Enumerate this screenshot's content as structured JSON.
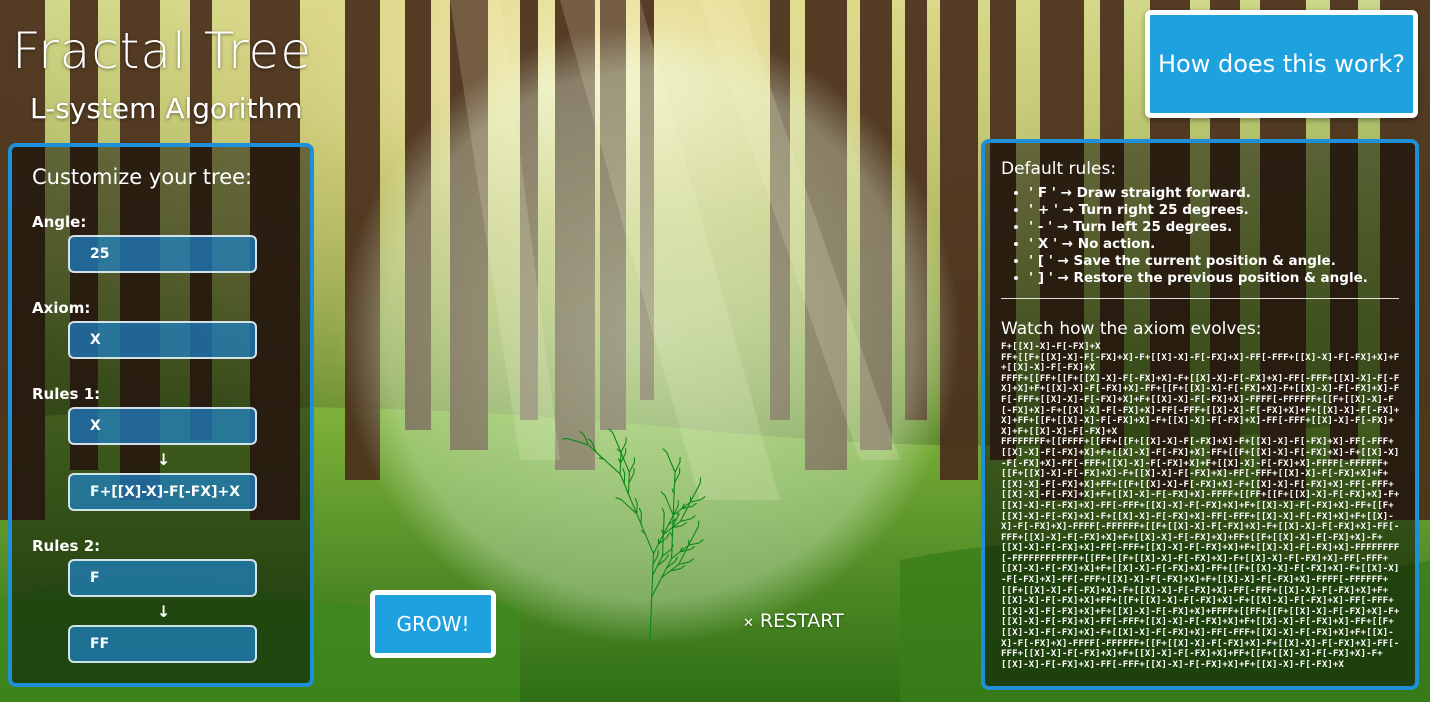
{
  "app": {
    "title": "Fractal Tree",
    "subtitle": "L-system Algorithm"
  },
  "buttons": {
    "how": "How does this work?",
    "grow": "GROW!",
    "restart": "RESTART"
  },
  "customize": {
    "heading": "Customize your tree:",
    "angle_label": "Angle:",
    "angle_value": "25",
    "axiom_label": "Axiom:",
    "axiom_value": "X",
    "rules1_label": "Rules 1:",
    "rules1_from": "X",
    "rules1_to": "F+[[X]-X]-F[-FX]+X",
    "rules2_label": "Rules 2:",
    "rules2_from": "F",
    "rules2_to": "FF",
    "arrow": "↓"
  },
  "rules_panel": {
    "heading": "Default rules:",
    "rules": [
      "' F ' → Draw straight forward.",
      "' + ' → Turn right 25 degrees.",
      "' - ' → Turn left 25 degrees.",
      "' X ' → No action.",
      "' [ ' → Save the current position & angle.",
      "' ] ' → Restore the previous position & angle."
    ],
    "evolve_heading": "Watch how the axiom evolves:",
    "evolution": [
      "F+[[X]-X]-F[-FX]+X",
      "FF+[[F+[[X]-X]-F[-FX]+X]-F+[[X]-X]-F[-FX]+X]-FF[-FFF+[[X]-X]-F[-FX]+X]+F+[[X]-X]-F[-FX]+X",
      "FFFF+[[FF+[[F+[[X]-X]-F[-FX]+X]-F+[[X]-X]-F[-FX]+X]-FF[-FFF+[[X]-X]-F[-FX]+X]+F+[[X]-X]-F[-FX]+X]-FF+[[F+[[X]-X]-F[-FX]+X]-F+[[X]-X]-F[-FX]+X]-FF[-FFF+[[X]-X]-F[-FX]+X]+F+[[X]-X]-F[-FX]+X]-FFFF[-FFFFFF+[[F+[[X]-X]-F[-FX]+X]-F+[[X]-X]-F[-FX]+X]-FF[-FFF+[[X]-X]-F[-FX]+X]+F+[[X]-X]-F[-FX]+X]+FF+[[F+[[X]-X]-F[-FX]+X]-F+[[X]-X]-F[-FX]+X]-FF[-FFF+[[X]-X]-F[-FX]+X]+F+[[X]-X]-F[-FX]+X",
      "FFFFFFFF+[[FFFF+[[FF+[[F+[[X]-X]-F[-FX]+X]-F+[[X]-X]-F[-FX]+X]-FF[-FFF+[[X]-X]-F[-FX]+X]+F+[[X]-X]-F[-FX]+X]-FF+[[F+[[X]-X]-F[-FX]+X]-F+[[X]-X]-F[-FX]+X]-FF[-FFF+[[X]-X]-F[-FX]+X]+F+[[X]-X]-F[-FX]+X]-FFFF[-FFFFFF+[[F+[[X]-X]-F[-FX]+X]-F+[[X]-X]-F[-FX]+X]-FF[-FFF+[[X]-X]-F[-FX]+X]+F+[[X]-X]-F[-FX]+X]+FF+[[F+[[X]-X]-F[-FX]+X]-F+[[X]-X]-F[-FX]+X]-FF[-FFF+[[X]-X]-F[-FX]+X]+F+[[X]-X]-F[-FX]+X]-FFFF+[[FF+[[F+[[X]-X]-F[-FX]+X]-F+[[X]-X]-F[-FX]+X]-FF[-FFF+[[X]-X]-F[-FX]+X]+F+[[X]-X]-F[-FX]+X]-FF+[[F+[[X]-X]-F[-FX]+X]-F+[[X]-X]-F[-FX]+X]-FF[-FFF+[[X]-X]-F[-FX]+X]+F+[[X]-X]-F[-FX]+X]-FFFF[-FFFFFF+[[F+[[X]-X]-F[-FX]+X]-F+[[X]-X]-F[-FX]+X]-FF[-FFF+[[X]-X]-F[-FX]+X]+F+[[X]-X]-F[-FX]+X]+FF+[[F+[[X]-X]-F[-FX]+X]-F+[[X]-X]-F[-FX]+X]-FF[-FFF+[[X]-X]-F[-FX]+X]+F+[[X]-X]-F[-FX]+X]-FFFFFFFF[-FFFFFFFFFFFF+[[FF+[[F+[[X]-X]-F[-FX]+X]-F+[[X]-X]-F[-FX]+X]-FF[-FFF+[[X]-X]-F[-FX]+X]+F+[[X]-X]-F[-FX]+X]-FF+[[F+[[X]-X]-F[-FX]+X]-F+[[X]-X]-F[-FX]+X]-FF[-FFF+[[X]-X]-F[-FX]+X]+F+[[X]-X]-F[-FX]+X]-FFFF[-FFFFFF+[[F+[[X]-X]-F[-FX]+X]-F+[[X]-X]-F[-FX]+X]-FF[-FFF+[[X]-X]-F[-FX]+X]+F+[[X]-X]-F[-FX]+X]+FF+[[F+[[X]-X]-F[-FX]+X]-F+[[X]-X]-F[-FX]+X]-FF[-FFF+[[X]-X]-F[-FX]+X]+F+[[X]-X]-F[-FX]+X]+FFFF+[[FF+[[F+[[X]-X]-F[-FX]+X]-F+[[X]-X]-F[-FX]+X]-FF[-FFF+[[X]-X]-F[-FX]+X]+F+[[X]-X]-F[-FX]+X]-FF+[[F+[[X]-X]-F[-FX]+X]-F+[[X]-X]-F[-FX]+X]-FF[-FFF+[[X]-X]-F[-FX]+X]+F+[[X]-X]-F[-FX]+X]-FFFF[-FFFFFF+[[F+[[X]-X]-F[-FX]+X]-F+[[X]-X]-F[-FX]+X]-FF[-FFF+[[X]-X]-F[-FX]+X]+F+[[X]-X]-F[-FX]+X]+FF+[[F+[[X]-X]-F[-FX]+X]-F+[[X]-X]-F[-FX]+X]-FF[-FFF+[[X]-X]-F[-FX]+X]+F+[[X]-X]-F[-FX]+X"
    ]
  },
  "colors": {
    "accent": "#1ea1df",
    "panel_border": "#1e8fd8",
    "tree": "#0a8a14"
  }
}
